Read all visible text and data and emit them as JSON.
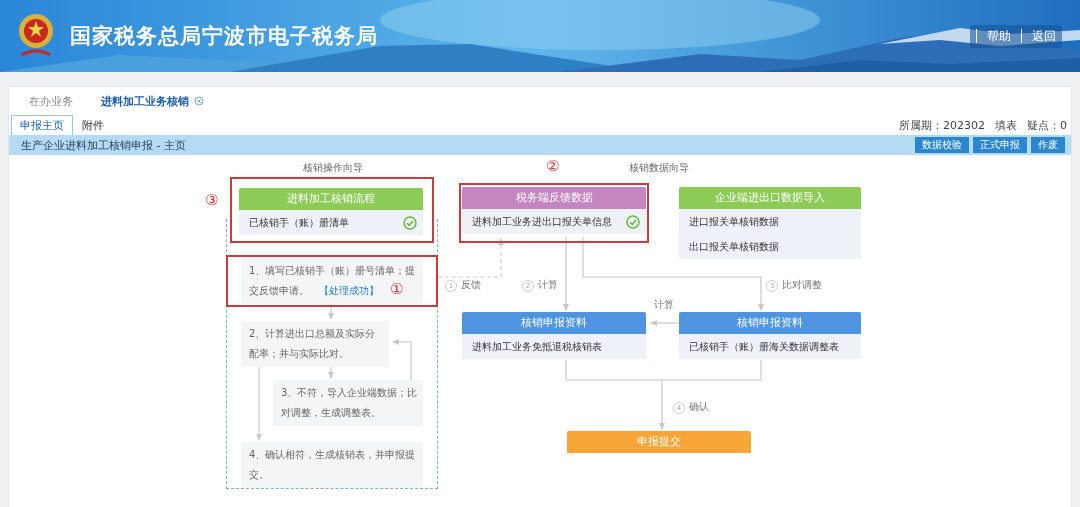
{
  "header": {
    "title": "国家税务总局宁波市电子税务局",
    "links": [
      "帮助",
      "返回"
    ]
  },
  "breadcrumb": [
    {
      "label": "在办业务",
      "selected": false
    },
    {
      "label": "进料加工业务核销",
      "selected": true
    }
  ],
  "tabs": [
    {
      "label": "申报主页",
      "selected": true
    },
    {
      "label": "附件",
      "selected": false
    }
  ],
  "period_info": [
    "所属期：202302",
    "填表",
    "疑点：0"
  ],
  "section_bar": {
    "title": "生产企业进料加工核销申报 - 主页",
    "buttons": [
      "数据校验",
      "正式申报",
      "作废"
    ]
  },
  "diagram": {
    "headings": [
      "核销操作向导",
      "核销数据向导"
    ],
    "nodes": [
      {
        "title": "进料加工核销流程",
        "color": "#8ccb56",
        "rows": [
          {
            "label": "已核销手（账）册清单",
            "checked": true
          }
        ]
      },
      {
        "title": "税务端反馈数据",
        "color": "#c585c0",
        "rows": [
          {
            "label": "进料加工业务进出口报关单信息",
            "checked": true
          }
        ]
      },
      {
        "title": "企业端进出口数据导入",
        "color": "#8ccb56",
        "rows": [
          {
            "label": "进口报关单核销数据",
            "checked": false
          },
          {
            "label": "出口报关单核销数据",
            "checked": false
          }
        ]
      },
      {
        "title": "核销申报资料",
        "color": "#4f94e0",
        "rows": [
          {
            "label": "进料加工业务免抵退税核销表",
            "checked": false
          }
        ]
      },
      {
        "title": "核销申报资料",
        "color": "#4f94e0",
        "rows": [
          {
            "label": "已核销手（账）册海关数据调整表",
            "checked": false
          }
        ]
      },
      {
        "title": "申报提交",
        "color": "#f7a537"
      }
    ],
    "steps": [
      {
        "text": "1、填写已核销手（账）册号清单；提交反馈申请。",
        "link": "【处理成功】"
      },
      {
        "text": "2、计算进出口总额及实际分配率；并与实际比对。"
      },
      {
        "text": "3、不符，导入企业端数据；比对调整，生成调整表。"
      },
      {
        "text": "4、确认相符，生成核销表，并申报提交。"
      }
    ],
    "edge_labels": [
      {
        "number": "1",
        "label": "反馈"
      },
      {
        "number": "2",
        "label": "计算"
      },
      {
        "number": "3",
        "label": "比对调整"
      },
      {
        "label": "计算"
      },
      {
        "number": "4",
        "label": "确认"
      }
    ],
    "annotations": [
      "③",
      "①",
      "②"
    ]
  }
}
